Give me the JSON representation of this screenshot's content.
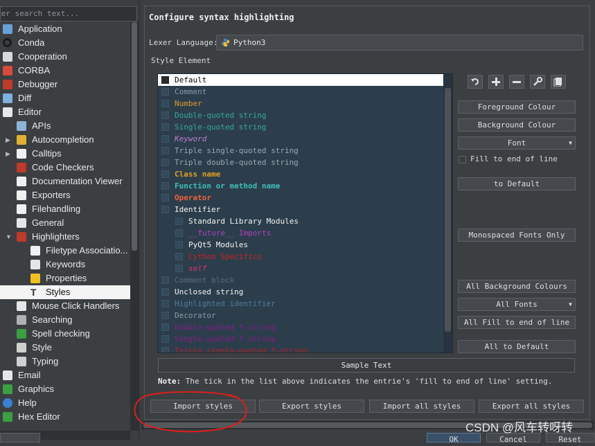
{
  "search": {
    "placeholder": "ter search text..."
  },
  "tree": [
    {
      "label": "Application",
      "icon": "application-icon",
      "level": 0,
      "color": "#6aa0d8"
    },
    {
      "label": "Conda",
      "icon": "conda-icon",
      "level": 0,
      "color": "#222222"
    },
    {
      "label": "Cooperation",
      "icon": "cooperation-icon",
      "level": 0,
      "color": "#d9d9d9"
    },
    {
      "label": "CORBA",
      "icon": "corba-icon",
      "level": 0,
      "color": "#d94a3a"
    },
    {
      "label": "Debugger",
      "icon": "debugger-icon",
      "level": 0,
      "color": "#c0392b"
    },
    {
      "label": "Diff",
      "icon": "diff-icon",
      "level": 0,
      "color": "#7fb0e0"
    },
    {
      "label": "Editor",
      "icon": "editor-icon",
      "level": 0,
      "color": "#e6e6e6"
    },
    {
      "label": "APIs",
      "icon": "apis-icon",
      "level": 1,
      "color": "#8fb3d8"
    },
    {
      "label": "Autocompletion",
      "icon": "autocompletion-icon",
      "level": 1,
      "color": "#e0b030",
      "expander": true
    },
    {
      "label": "Calltips",
      "icon": "calltips-icon",
      "level": 1,
      "color": "#f0f0f0",
      "expander": true
    },
    {
      "label": "Code Checkers",
      "icon": "code-checkers-icon",
      "level": 1,
      "color": "#c0392b"
    },
    {
      "label": "Documentation Viewer",
      "icon": "documentation-icon",
      "level": 1,
      "color": "#f0f0f0"
    },
    {
      "label": "Exporters",
      "icon": "exporters-icon",
      "level": 1,
      "color": "#f0f0f0"
    },
    {
      "label": "Filehandling",
      "icon": "filehandling-icon",
      "level": 1,
      "color": "#f0f0f0"
    },
    {
      "label": "General",
      "icon": "general-icon",
      "level": 1,
      "color": "#e6e6e6"
    },
    {
      "label": "Highlighters",
      "icon": "highlighters-icon",
      "level": 1,
      "color": "#c0392b",
      "expanded": true
    },
    {
      "label": "Filetype Associatio...",
      "icon": "filetype-icon",
      "level": 2,
      "color": "#f0f0f0"
    },
    {
      "label": "Keywords",
      "icon": "keywords-icon",
      "level": 2,
      "color": "#e6e6e6"
    },
    {
      "label": "Properties",
      "icon": "properties-icon",
      "level": 2,
      "color": "#f0c020"
    },
    {
      "label": "Styles",
      "icon": "styles-icon",
      "level": 2,
      "color": "#333333",
      "selected": true
    },
    {
      "label": "Mouse Click Handlers",
      "icon": "mouse-icon",
      "level": 1,
      "color": "#e6e6e6"
    },
    {
      "label": "Searching",
      "icon": "searching-icon",
      "level": 1,
      "color": "#b0b0b0"
    },
    {
      "label": "Spell checking",
      "icon": "spellcheck-icon",
      "level": 1,
      "color": "#3aa040"
    },
    {
      "label": "Style",
      "icon": "style-icon",
      "level": 1,
      "color": "#d0d0d0"
    },
    {
      "label": "Typing",
      "icon": "typing-icon",
      "level": 1,
      "color": "#d0d0d0"
    },
    {
      "label": "Email",
      "icon": "email-icon",
      "level": 0,
      "color": "#e6e6e6"
    },
    {
      "label": "Graphics",
      "icon": "graphics-icon",
      "level": 0,
      "color": "#3aa040"
    },
    {
      "label": "Help",
      "icon": "help-icon",
      "level": 0,
      "color": "#3a7fd8"
    },
    {
      "label": "Hex Editor",
      "icon": "hex-editor-icon",
      "level": 0,
      "color": "#3aa040"
    }
  ],
  "panel": {
    "title": "Configure syntax highlighting",
    "lexer_label": "Lexer Language:",
    "lexer_value": "Python3",
    "style_element_label": "Style Element"
  },
  "styles": [
    {
      "label": "Default",
      "color": "#000000",
      "level": 0,
      "selected": true
    },
    {
      "label": "Comment",
      "color": "#8a9aa6",
      "level": 0
    },
    {
      "label": "Number",
      "color": "#e09a2a",
      "level": 0
    },
    {
      "label": "Double-quoted string",
      "color": "#36a9a0",
      "level": 0
    },
    {
      "label": "Single-quoted string",
      "color": "#36a9a0",
      "level": 0
    },
    {
      "label": "Keyword",
      "color": "#c07ad0",
      "level": 0,
      "italic": true
    },
    {
      "label": "Triple single-quoted string",
      "color": "#9aa9b4",
      "level": 0
    },
    {
      "label": "Triple double-quoted string",
      "color": "#9aa9b4",
      "level": 0
    },
    {
      "label": "Class name",
      "color": "#e0a020",
      "level": 0,
      "bold": true
    },
    {
      "label": "Function or method name",
      "color": "#3fbfb8",
      "level": 0,
      "bold": true
    },
    {
      "label": "Operator",
      "color": "#f0603a",
      "level": 0,
      "bold": true
    },
    {
      "label": "Identifier",
      "color": "#f4f4f4",
      "level": 0
    },
    {
      "label": "Standard Library Modules",
      "color": "#f4f4f4",
      "level": 1
    },
    {
      "label": "__future__ Imports",
      "color": "#b040c0",
      "level": 1
    },
    {
      "label": "PyQt5 Modules",
      "color": "#f4f4f4",
      "level": 1
    },
    {
      "label": "Cython Specifics",
      "color": "#d02020",
      "level": 1
    },
    {
      "label": "self",
      "color": "#e03070",
      "level": 1,
      "italic": true
    },
    {
      "label": "Comment block",
      "color": "#5a6e7c",
      "level": 0
    },
    {
      "label": "Unclosed string",
      "color": "#f4f4f4",
      "level": 0
    },
    {
      "label": "Highlighted identifier",
      "color": "#4e7e9e",
      "level": 0
    },
    {
      "label": "Decorator",
      "color": "#8a9aa6",
      "level": 0
    },
    {
      "label": "Double-quoted f-string",
      "color": "#8a1a8a",
      "level": 0
    },
    {
      "label": "Single-quoted f-string",
      "color": "#8a1a8a",
      "level": 0
    },
    {
      "label": "Triple single-quoted f-string",
      "color": "#c01a1a",
      "level": 0
    }
  ],
  "buttons": {
    "foreground": "Foreground Colour",
    "background": "Background Colour",
    "font": "Font",
    "fill_to_end": "Fill to end of line",
    "to_default": "to Default",
    "monospaced_only": "Monospaced Fonts Only",
    "all_background": "All Background Colours",
    "all_fonts": "All Fonts",
    "all_fill": "All Fill to end of line",
    "all_to_default": "All to Default",
    "import_styles": "Import styles",
    "export_styles": "Export styles",
    "import_all": "Import all styles",
    "export_all": "Export all styles"
  },
  "sample_text": "Sample Text",
  "note": {
    "prefix": "Note:",
    "text": " The tick in the list above indicates the entrie's 'fill to end of line' setting."
  },
  "dialog": {
    "ok": "OK",
    "cancel": "Cancel",
    "reset": "Reset"
  },
  "watermark": "CSDN @风车转呀转"
}
